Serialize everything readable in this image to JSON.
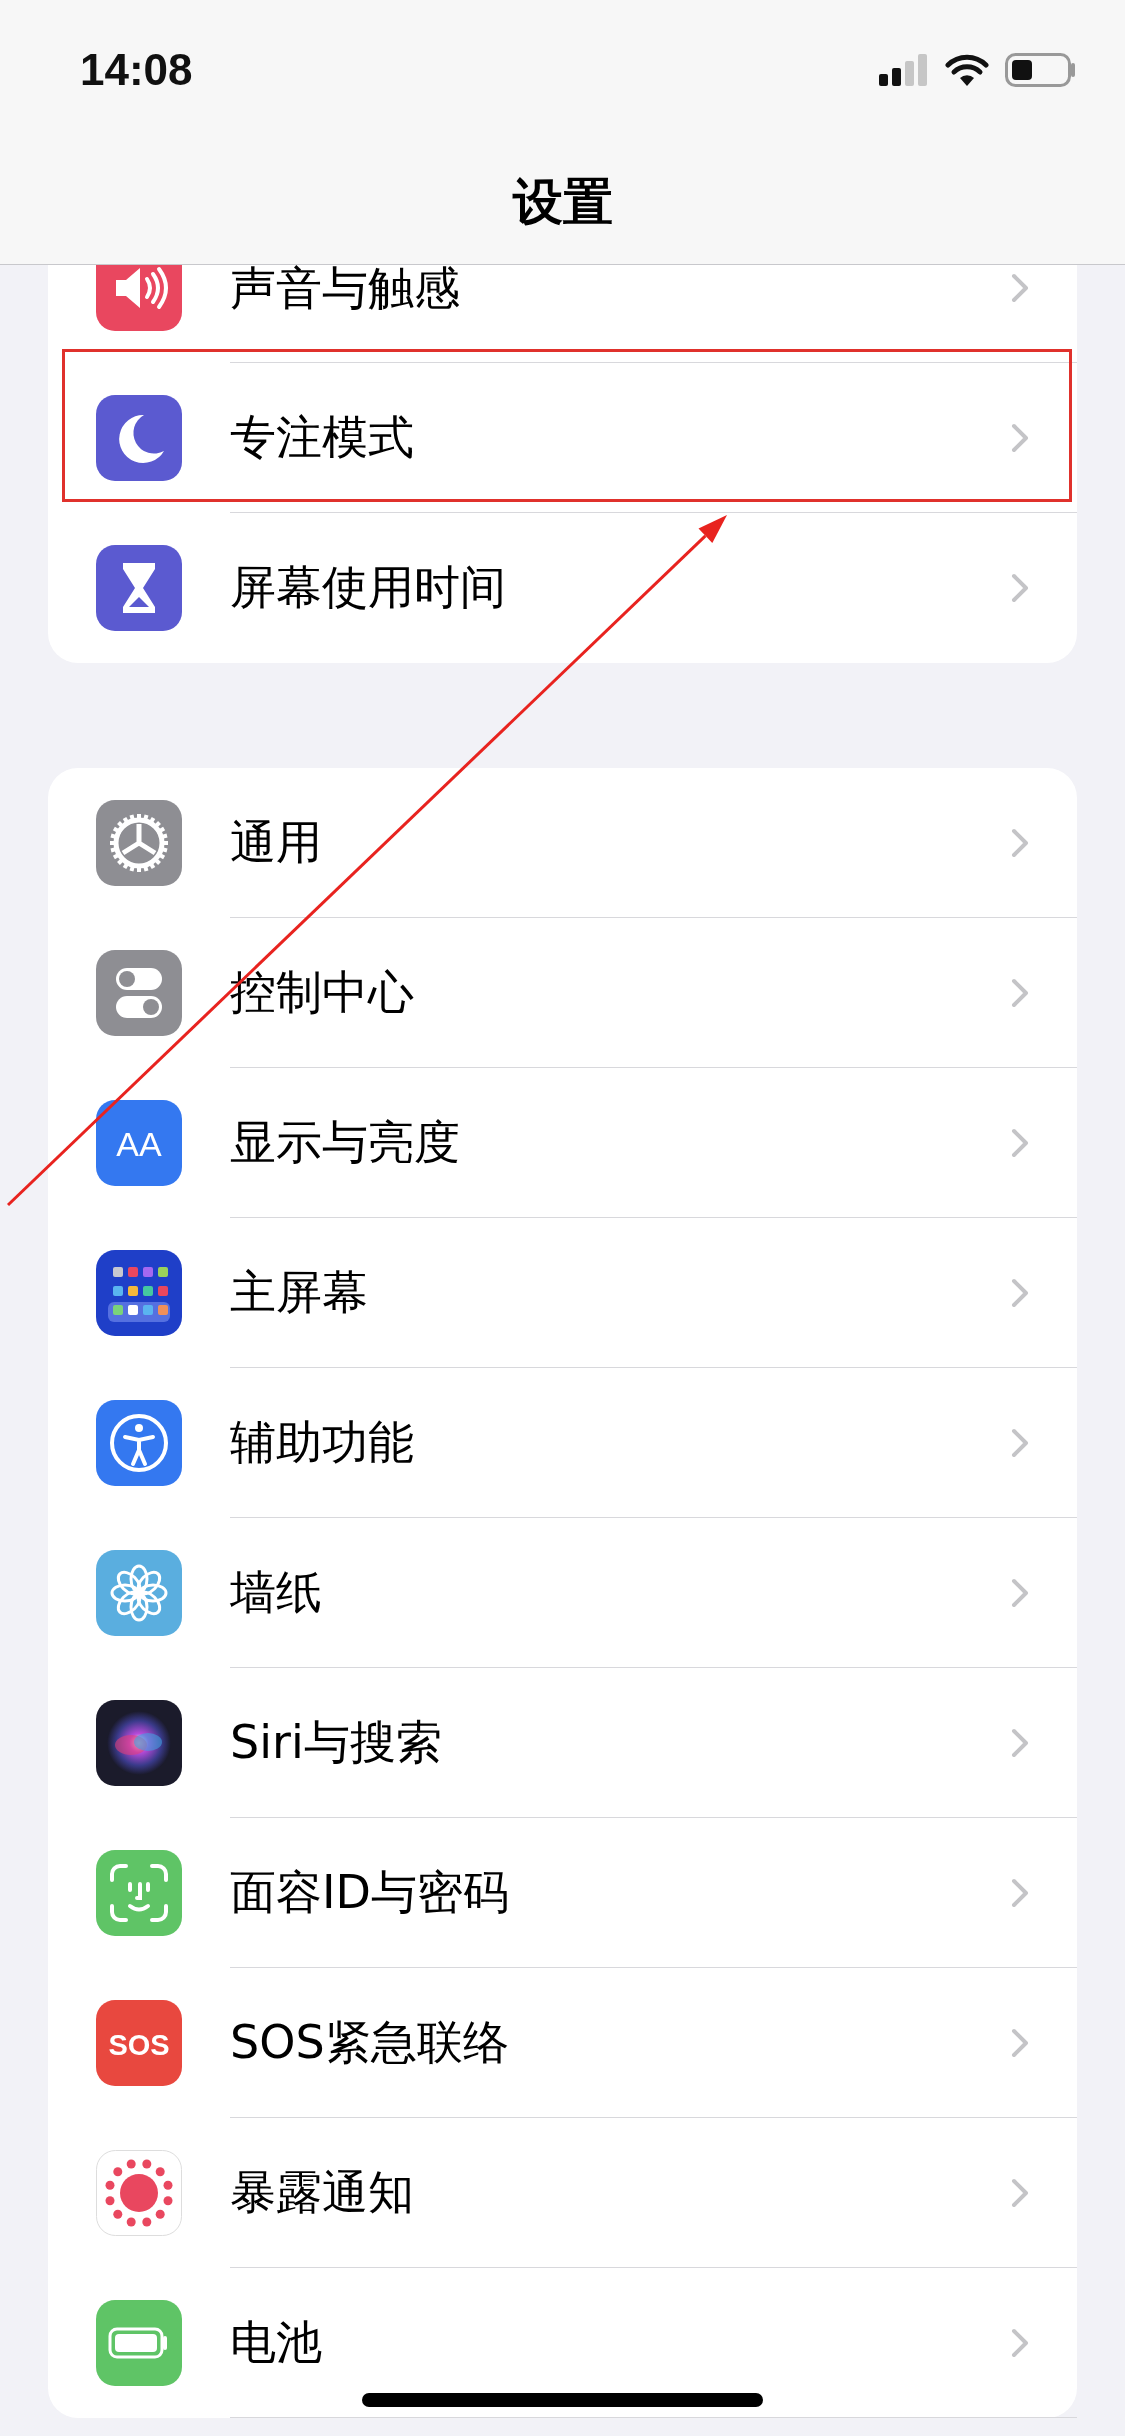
{
  "status_bar": {
    "time": "14:08"
  },
  "title": "设置",
  "groups": [
    {
      "items": [
        {
          "label": "声音与触感",
          "kind": "sound",
          "highlighted": false
        },
        {
          "label": "专注模式",
          "kind": "focus",
          "highlighted": true
        },
        {
          "label": "屏幕使用时间",
          "kind": "screen-time",
          "highlighted": false
        }
      ]
    },
    {
      "items": [
        {
          "label": "通用",
          "kind": "general",
          "highlighted": false
        },
        {
          "label": "控制中心",
          "kind": "control-center",
          "highlighted": false
        },
        {
          "label": "显示与亮度",
          "kind": "display",
          "icon_text": "AA",
          "highlighted": false
        },
        {
          "label": "主屏幕",
          "kind": "home-screen",
          "highlighted": false
        },
        {
          "label": "辅助功能",
          "kind": "accessibility",
          "highlighted": false
        },
        {
          "label": "墙纸",
          "kind": "wallpaper",
          "highlighted": false
        },
        {
          "label": "Siri与搜索",
          "kind": "siri",
          "highlighted": false
        },
        {
          "label": "面容ID与密码",
          "kind": "face-id",
          "highlighted": false
        },
        {
          "label": "SOS紧急联络",
          "kind": "sos",
          "icon_text": "SOS",
          "highlighted": false
        },
        {
          "label": "暴露通知",
          "kind": "exposure",
          "highlighted": false
        },
        {
          "label": "电池",
          "kind": "battery",
          "highlighted": false
        }
      ]
    }
  ],
  "annotation_arrow": true
}
